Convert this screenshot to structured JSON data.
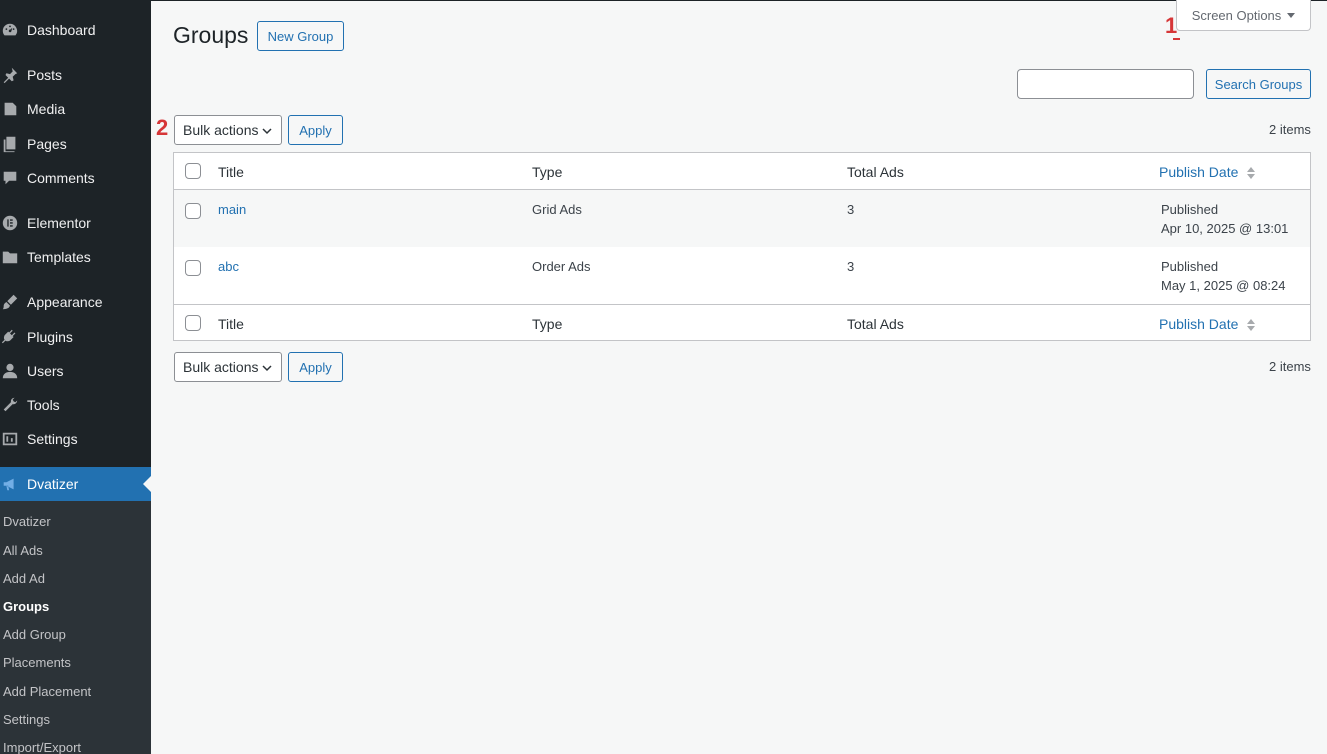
{
  "sidebar": {
    "items": [
      {
        "label": "Dashboard",
        "icon": "dashboard-icon"
      },
      {
        "label": "Posts",
        "icon": "pushpin-icon"
      },
      {
        "label": "Media",
        "icon": "media-icon"
      },
      {
        "label": "Pages",
        "icon": "pages-icon"
      },
      {
        "label": "Comments",
        "icon": "comment-icon"
      },
      {
        "label": "Elementor",
        "icon": "elementor-icon"
      },
      {
        "label": "Templates",
        "icon": "folder-icon"
      },
      {
        "label": "Appearance",
        "icon": "paintbrush-icon"
      },
      {
        "label": "Plugins",
        "icon": "plugin-icon"
      },
      {
        "label": "Users",
        "icon": "user-icon"
      },
      {
        "label": "Tools",
        "icon": "wrench-icon"
      },
      {
        "label": "Settings",
        "icon": "settings-icon"
      },
      {
        "label": "Dvatizer",
        "icon": "megaphone-icon"
      }
    ],
    "submenu": [
      "Dvatizer",
      "All Ads",
      "Add Ad",
      "Groups",
      "Add Group",
      "Placements",
      "Add Placement",
      "Settings",
      "Import/Export"
    ]
  },
  "header": {
    "title": "Groups",
    "new_button": "New Group",
    "screen_options": "Screen Options"
  },
  "search": {
    "button": "Search Groups",
    "value": ""
  },
  "bulk": {
    "select": "Bulk actions",
    "apply": "Apply",
    "count": "2 items"
  },
  "annotations": {
    "one": "1",
    "two": "2"
  },
  "table": {
    "columns": [
      "Title",
      "Type",
      "Total Ads",
      "Publish Date"
    ],
    "rows": [
      {
        "title": "main",
        "type": "Grid Ads",
        "total": "3",
        "status": "Published",
        "date": "Apr 10, 2025 @ 13:01"
      },
      {
        "title": "abc",
        "type": "Order Ads",
        "total": "3",
        "status": "Published",
        "date": "May 1, 2025 @ 08:24"
      }
    ]
  },
  "colors": {
    "accent": "#2271b1",
    "sidebar": "#1d2327",
    "annotation": "#d63638"
  }
}
